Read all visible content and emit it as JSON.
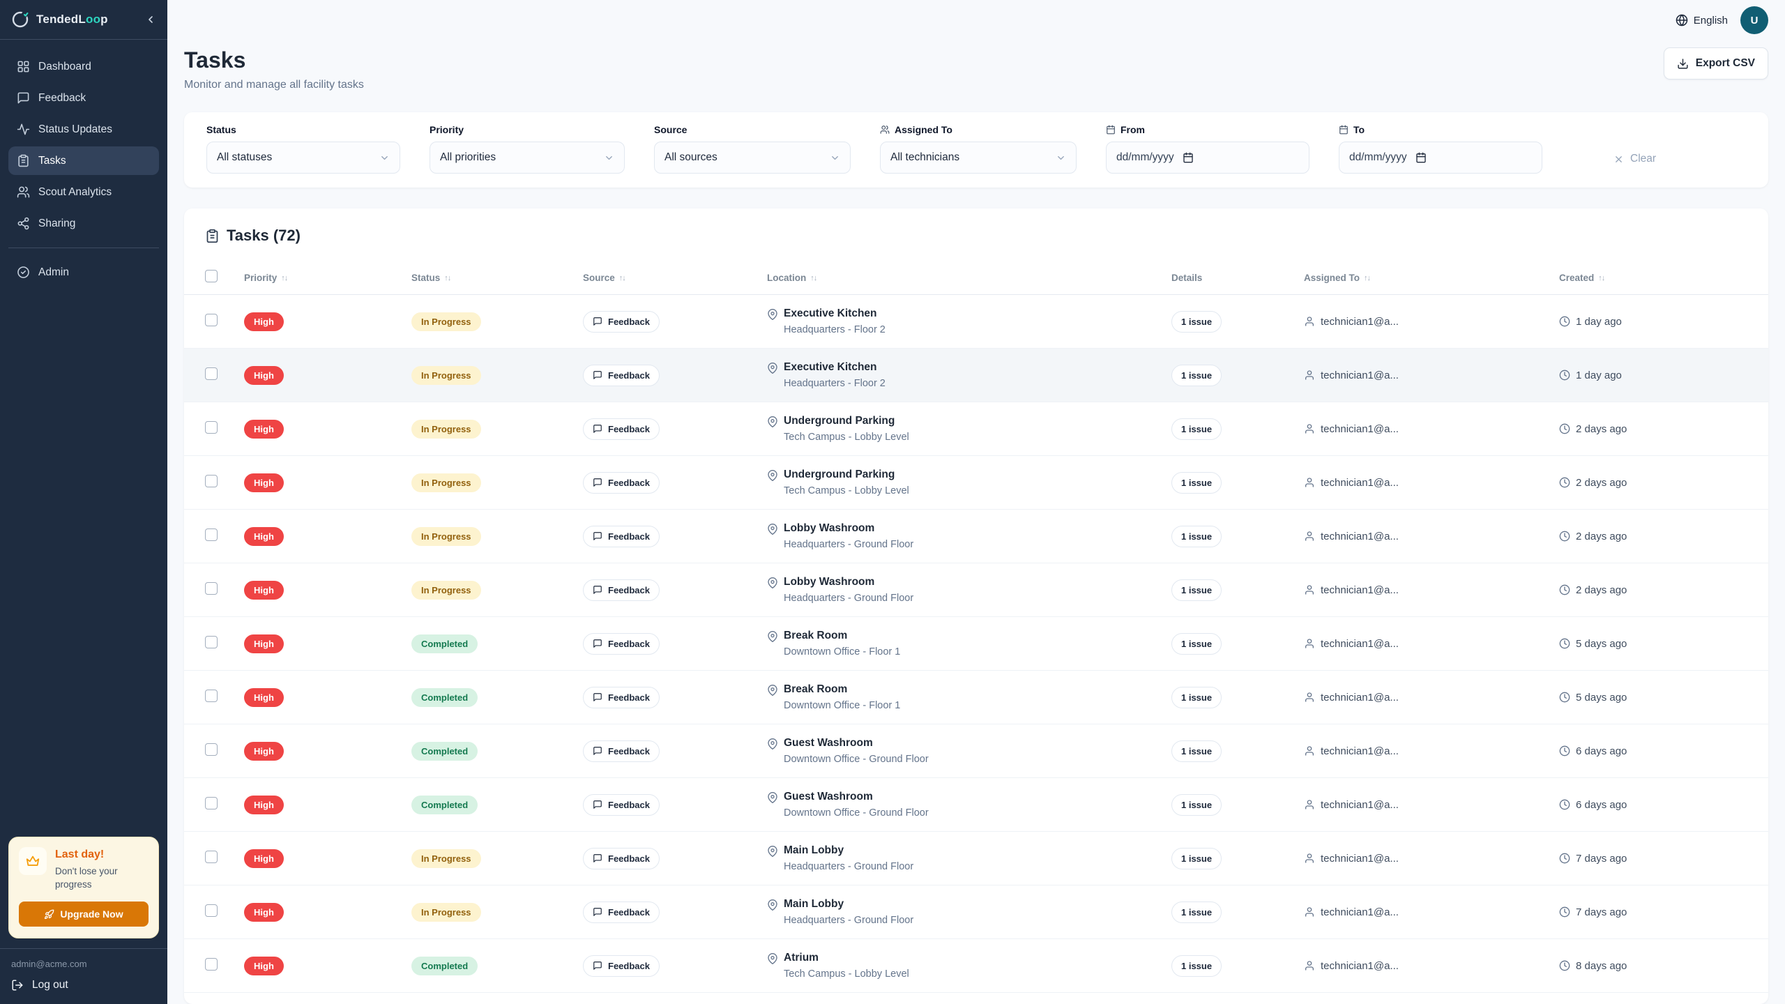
{
  "brand": {
    "name_part1": "TendedL",
    "name_part2": "oo",
    "name_part3": "p"
  },
  "topbar": {
    "language": "English",
    "avatar_initial": "U"
  },
  "sidebar": {
    "items": [
      {
        "label": "Dashboard"
      },
      {
        "label": "Feedback"
      },
      {
        "label": "Status Updates"
      },
      {
        "label": "Tasks",
        "active": true
      },
      {
        "label": "Scout Analytics"
      },
      {
        "label": "Sharing"
      }
    ],
    "admin_label": "Admin",
    "promo": {
      "title": "Last day!",
      "subtitle": "Don't lose your progress",
      "button": "Upgrade Now"
    },
    "footer": {
      "email": "admin@acme.com",
      "logout": "Log out"
    }
  },
  "page": {
    "title": "Tasks",
    "subtitle": "Monitor and manage all facility tasks",
    "export_button": "Export CSV"
  },
  "filters": {
    "status": {
      "label": "Status",
      "value": "All statuses"
    },
    "priority": {
      "label": "Priority",
      "value": "All priorities"
    },
    "source": {
      "label": "Source",
      "value": "All sources"
    },
    "assigned_to": {
      "label": "Assigned To",
      "value": "All technicians"
    },
    "from": {
      "label": "From",
      "placeholder": "dd/mm/yyyy"
    },
    "to": {
      "label": "To",
      "placeholder": "dd/mm/yyyy"
    },
    "clear_label": "Clear"
  },
  "table": {
    "title": "Tasks (72)",
    "columns": [
      {
        "label": "Priority",
        "sortable": true
      },
      {
        "label": "Status",
        "sortable": true
      },
      {
        "label": "Source",
        "sortable": true
      },
      {
        "label": "Location",
        "sortable": true
      },
      {
        "label": "Details",
        "sortable": false
      },
      {
        "label": "Assigned To",
        "sortable": true
      },
      {
        "label": "Created",
        "sortable": true
      }
    ],
    "rows": [
      {
        "priority": "High",
        "status": "In Progress",
        "source": "Feedback",
        "location": "Executive Kitchen",
        "location_detail": "Headquarters - Floor 2",
        "details": "1 issue",
        "assigned_to": "technician1@a...",
        "created": "1 day ago"
      },
      {
        "priority": "High",
        "status": "In Progress",
        "source": "Feedback",
        "location": "Executive Kitchen",
        "location_detail": "Headquarters - Floor 2",
        "details": "1 issue",
        "assigned_to": "technician1@a...",
        "created": "1 day ago",
        "highlighted": true
      },
      {
        "priority": "High",
        "status": "In Progress",
        "source": "Feedback",
        "location": "Underground Parking",
        "location_detail": "Tech Campus - Lobby Level",
        "details": "1 issue",
        "assigned_to": "technician1@a...",
        "created": "2 days ago"
      },
      {
        "priority": "High",
        "status": "In Progress",
        "source": "Feedback",
        "location": "Underground Parking",
        "location_detail": "Tech Campus - Lobby Level",
        "details": "1 issue",
        "assigned_to": "technician1@a...",
        "created": "2 days ago"
      },
      {
        "priority": "High",
        "status": "In Progress",
        "source": "Feedback",
        "location": "Lobby Washroom",
        "location_detail": "Headquarters - Ground Floor",
        "details": "1 issue",
        "assigned_to": "technician1@a...",
        "created": "2 days ago"
      },
      {
        "priority": "High",
        "status": "In Progress",
        "source": "Feedback",
        "location": "Lobby Washroom",
        "location_detail": "Headquarters - Ground Floor",
        "details": "1 issue",
        "assigned_to": "technician1@a...",
        "created": "2 days ago"
      },
      {
        "priority": "High",
        "status": "Completed",
        "source": "Feedback",
        "location": "Break Room",
        "location_detail": "Downtown Office - Floor 1",
        "details": "1 issue",
        "assigned_to": "technician1@a...",
        "created": "5 days ago"
      },
      {
        "priority": "High",
        "status": "Completed",
        "source": "Feedback",
        "location": "Break Room",
        "location_detail": "Downtown Office - Floor 1",
        "details": "1 issue",
        "assigned_to": "technician1@a...",
        "created": "5 days ago"
      },
      {
        "priority": "High",
        "status": "Completed",
        "source": "Feedback",
        "location": "Guest Washroom",
        "location_detail": "Downtown Office - Ground Floor",
        "details": "1 issue",
        "assigned_to": "technician1@a...",
        "created": "6 days ago"
      },
      {
        "priority": "High",
        "status": "Completed",
        "source": "Feedback",
        "location": "Guest Washroom",
        "location_detail": "Downtown Office - Ground Floor",
        "details": "1 issue",
        "assigned_to": "technician1@a...",
        "created": "6 days ago"
      },
      {
        "priority": "High",
        "status": "In Progress",
        "source": "Feedback",
        "location": "Main Lobby",
        "location_detail": "Headquarters - Ground Floor",
        "details": "1 issue",
        "assigned_to": "technician1@a...",
        "created": "7 days ago"
      },
      {
        "priority": "High",
        "status": "In Progress",
        "source": "Feedback",
        "location": "Main Lobby",
        "location_detail": "Headquarters - Ground Floor",
        "details": "1 issue",
        "assigned_to": "technician1@a...",
        "created": "7 days ago"
      },
      {
        "priority": "High",
        "status": "Completed",
        "source": "Feedback",
        "location": "Atrium",
        "location_detail": "Tech Campus - Lobby Level",
        "details": "1 issue",
        "assigned_to": "technician1@a...",
        "created": "8 days ago"
      }
    ]
  },
  "colors": {
    "accent_teal": "#2dd4bf",
    "avatar_bg": "#115e73",
    "priority_high": "#ef4444",
    "status_in_progress_bg": "#fdf3cf",
    "status_in_progress_text": "#92610e",
    "status_completed_bg": "#d7f2e3",
    "status_completed_text": "#157a50",
    "promo_orange": "#d97706",
    "promo_title": "#e2620e"
  }
}
